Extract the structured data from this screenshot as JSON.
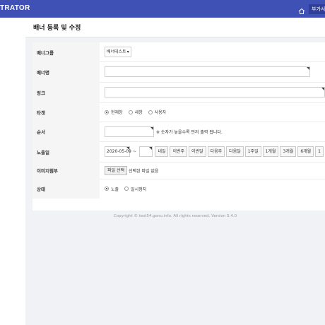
{
  "header": {
    "brand": "TRATOR",
    "addon_label": "부가서"
  },
  "page": {
    "title": "배너 등록 및 수정"
  },
  "form": {
    "group": {
      "label": "배너그룹",
      "selected": "배너테스트",
      "arrow": "▾"
    },
    "name": {
      "label": "배너명",
      "value": ""
    },
    "link": {
      "label": "링크",
      "value": ""
    },
    "target": {
      "label": "타겟",
      "options": [
        "현재창",
        "새창",
        "사용자"
      ],
      "selected_index": 0
    },
    "order": {
      "label": "순서",
      "value": "",
      "note": "※ 숫자가 높을수록 먼저 출력 됩니다."
    },
    "period": {
      "label": "노출일",
      "start": "2020-05-09",
      "sep": "~",
      "end": "",
      "quick": [
        "내일",
        "이번주",
        "이번달",
        "다음주",
        "다음달",
        "1주일",
        "1개월",
        "3개월",
        "6개월",
        "1"
      ]
    },
    "image": {
      "label": "이미지첨부",
      "button": "파일 선택",
      "status": "선택된 파일 없음"
    },
    "status": {
      "label": "상태",
      "options": [
        "노출",
        "일시정지"
      ],
      "selected_index": 0
    }
  },
  "footer": {
    "text": "Copyright © test54.gonu.info. All rights reserved. Version 5.4.0"
  }
}
